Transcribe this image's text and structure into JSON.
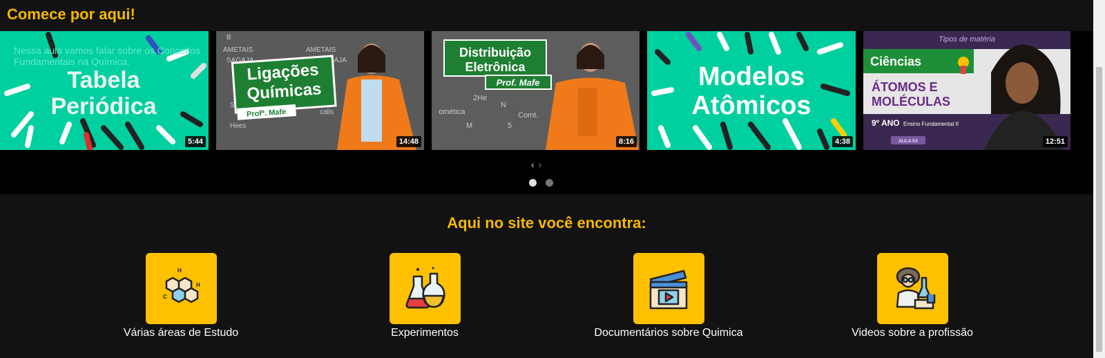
{
  "header": {
    "title": "Comece por aqui!"
  },
  "carousel": {
    "description": "Nessa aula vamos falar sobre os Conceitos Fundamentais na Química.",
    "videos": [
      {
        "title_line1": "Tabela",
        "title_line2": "Periódica",
        "duration": "5:44"
      },
      {
        "title_line1": "Ligações",
        "title_line2": "Químicas",
        "byline": "Profª. Mafe",
        "duration": "14:48"
      },
      {
        "title_line1": "Distribuição",
        "title_line2": "Eletrônica",
        "byline": "Prof. Mafe",
        "duration": "8:16"
      },
      {
        "title_line1": "Modelos",
        "title_line2": "Atômicos",
        "duration": "4:38"
      },
      {
        "tag": "Ciências",
        "title_line1": "ÁTOMOS E",
        "title_line2": "MOLÉCULAS",
        "grade": "9º ANO",
        "level": "Ensino Fundamental II",
        "lesson": "AULA 63",
        "top_text": "Tipos de matéria",
        "duration": "12:51"
      }
    ],
    "prev": "‹",
    "next": "›",
    "pages": 2,
    "active_page": 1
  },
  "features": {
    "title": "Aqui no site você encontra:",
    "items": [
      {
        "label": "Várias áreas de Estudo",
        "icon": "molecule-icon"
      },
      {
        "label": "Experimentos",
        "icon": "flask-icon"
      },
      {
        "label": "Documentários sobre Quimica",
        "icon": "clapperboard-icon"
      },
      {
        "label": "Videos sobre a profissão",
        "icon": "scientist-icon"
      }
    ]
  },
  "colors": {
    "accent": "#f5b800",
    "tile": "#ffc000",
    "teal": "#00d4a0",
    "green_badge": "#1e7f32",
    "orange": "#f07a1a"
  }
}
